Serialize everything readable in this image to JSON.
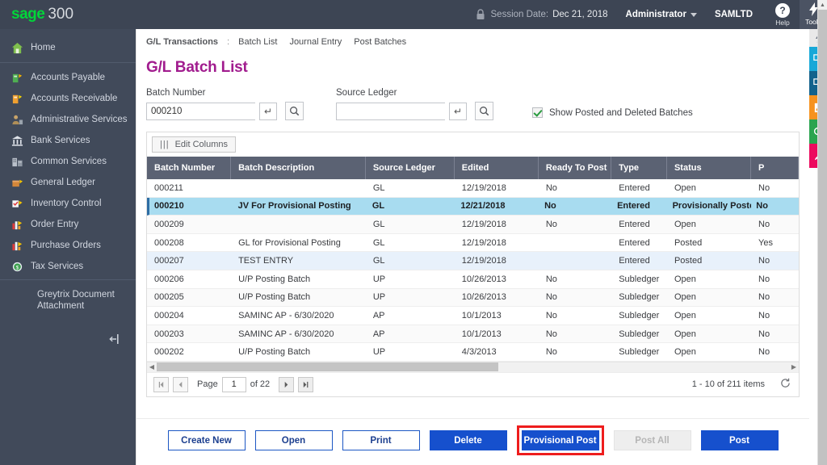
{
  "topbar": {
    "logo_sage": "sage",
    "logo_300": "300",
    "lock_icon": "lock-icon",
    "session_label": "Session Date:",
    "session_date": "Dec 21, 2018",
    "user": "Administrator",
    "company": "SAMLTD",
    "help_glyph": "?",
    "help_label": "Help",
    "tools_icon": "bolt-icon",
    "tools_label": "Tools"
  },
  "sidebar": {
    "home": {
      "label": "Home",
      "icon": "house-icon"
    },
    "items": [
      {
        "label": "Accounts Payable",
        "icon": "accounts-payable-icon"
      },
      {
        "label": "Accounts Receivable",
        "icon": "accounts-receivable-icon"
      },
      {
        "label": "Administrative Services",
        "icon": "administrative-services-icon"
      },
      {
        "label": "Bank Services",
        "icon": "bank-icon"
      },
      {
        "label": "Common Services",
        "icon": "common-services-icon"
      },
      {
        "label": "General Ledger",
        "icon": "general-ledger-icon"
      },
      {
        "label": "Inventory Control",
        "icon": "inventory-control-icon"
      },
      {
        "label": "Order Entry",
        "icon": "order-entry-icon"
      },
      {
        "label": "Purchase Orders",
        "icon": "purchase-orders-icon"
      },
      {
        "label": "Tax Services",
        "icon": "tax-services-icon"
      }
    ],
    "extra_label": "Greytrix Document Attachment",
    "collapse_icon": "collapse-sidebar-icon"
  },
  "breadcrumb": {
    "root": "G/L Transactions",
    "sep": ":",
    "links": [
      "Batch List",
      "Journal Entry",
      "Post Batches"
    ]
  },
  "page": {
    "title": "G/L Batch List"
  },
  "filters": {
    "batch_number_label": "Batch Number",
    "batch_number_value": "000210",
    "batch_number_placeholder": "",
    "source_ledger_label": "Source Ledger",
    "source_ledger_value": "",
    "source_ledger_placeholder": "",
    "enter_glyph": "↵",
    "search_icon": "search-icon",
    "checkbox_label": "Show Posted and Deleted Batches",
    "checkbox_checked": true
  },
  "grid": {
    "edit_columns_label": "Edit Columns",
    "edit_columns_icon": "columns-icon",
    "columns": [
      "Batch Number",
      "Batch Description",
      "Source Ledger",
      "Edited",
      "Ready To Post",
      "Type",
      "Status",
      "P"
    ],
    "rows": [
      {
        "batch": "000211",
        "desc": "",
        "ledger": "GL",
        "edited": "12/19/2018",
        "ready": "No",
        "type": "Entered",
        "status": "Open",
        "p": "No",
        "state": "plain"
      },
      {
        "batch": "000210",
        "desc": "JV For Provisional Posting",
        "ledger": "GL",
        "edited": "12/21/2018",
        "ready": "No",
        "type": "Entered",
        "status": "Provisionally Posted",
        "p": "No",
        "state": "selected"
      },
      {
        "batch": "000209",
        "desc": "",
        "ledger": "GL",
        "edited": "12/19/2018",
        "ready": "No",
        "type": "Entered",
        "status": "Open",
        "p": "No",
        "state": "alt"
      },
      {
        "batch": "000208",
        "desc": "GL for Provisional Posting",
        "ledger": "GL",
        "edited": "12/19/2018",
        "ready": "",
        "type": "Entered",
        "status": "Posted",
        "p": "Yes",
        "state": "plain"
      },
      {
        "batch": "000207",
        "desc": "TEST ENTRY",
        "ledger": "GL",
        "edited": "12/19/2018",
        "ready": "",
        "type": "Entered",
        "status": "Posted",
        "p": "No",
        "state": "lightblue"
      },
      {
        "batch": "000206",
        "desc": "U/P Posting Batch",
        "ledger": "UP",
        "edited": "10/26/2013",
        "ready": "No",
        "type": "Subledger",
        "status": "Open",
        "p": "No",
        "state": "plain"
      },
      {
        "batch": "000205",
        "desc": "U/P Posting Batch",
        "ledger": "UP",
        "edited": "10/26/2013",
        "ready": "No",
        "type": "Subledger",
        "status": "Open",
        "p": "No",
        "state": "alt"
      },
      {
        "batch": "000204",
        "desc": "SAMINC AP - 6/30/2020",
        "ledger": "AP",
        "edited": "10/1/2013",
        "ready": "No",
        "type": "Subledger",
        "status": "Open",
        "p": "No",
        "state": "plain"
      },
      {
        "batch": "000203",
        "desc": "SAMINC AP - 6/30/2020",
        "ledger": "AP",
        "edited": "10/1/2013",
        "ready": "No",
        "type": "Subledger",
        "status": "Open",
        "p": "No",
        "state": "alt"
      },
      {
        "batch": "000202",
        "desc": "U/P Posting Batch",
        "ledger": "UP",
        "edited": "4/3/2013",
        "ready": "No",
        "type": "Subledger",
        "status": "Open",
        "p": "No",
        "state": "plain"
      }
    ]
  },
  "pager": {
    "first_glyph": "⏮",
    "prev_glyph": "◀",
    "page_label": "Page",
    "page_value": "1",
    "of_label": "of 22",
    "next_glyph": "▶",
    "last_glyph": "⏭",
    "count_text": "1 - 10 of 211 items",
    "refresh_icon": "refresh-icon"
  },
  "footer": {
    "buttons": [
      {
        "label": "Create New",
        "style": "ghost",
        "highlight": false
      },
      {
        "label": "Open",
        "style": "ghost",
        "highlight": false
      },
      {
        "label": "Print",
        "style": "ghost",
        "highlight": false
      },
      {
        "label": "Delete",
        "style": "primary",
        "highlight": false
      },
      {
        "label": "Provisional Post",
        "style": "primary",
        "highlight": true
      },
      {
        "label": "Post All",
        "style": "disabled",
        "highlight": false
      },
      {
        "label": "Post",
        "style": "primary",
        "highlight": false
      }
    ]
  },
  "rail": {
    "bolt_icon": "bolt-icon",
    "buttons": [
      {
        "icon": "screen-2-icon",
        "color": "#18a8d8"
      },
      {
        "icon": "screen-clock-icon",
        "color": "#12628c"
      },
      {
        "icon": "report-icon",
        "color": "#f6921e"
      },
      {
        "icon": "search-icon",
        "color": "#2aa44f"
      },
      {
        "icon": "pen-icon",
        "color": "#ec0a5e"
      }
    ]
  },
  "colors": {
    "brand_green": "#00d639",
    "header_navy": "#3d4554",
    "sidebar": "#414a5a",
    "title_purple": "#a11c8e",
    "grid_header": "#5b6273",
    "row_selected": "#a8dcf0",
    "primary_button": "#1650cd",
    "highlight_red": "#ee1d1d"
  }
}
